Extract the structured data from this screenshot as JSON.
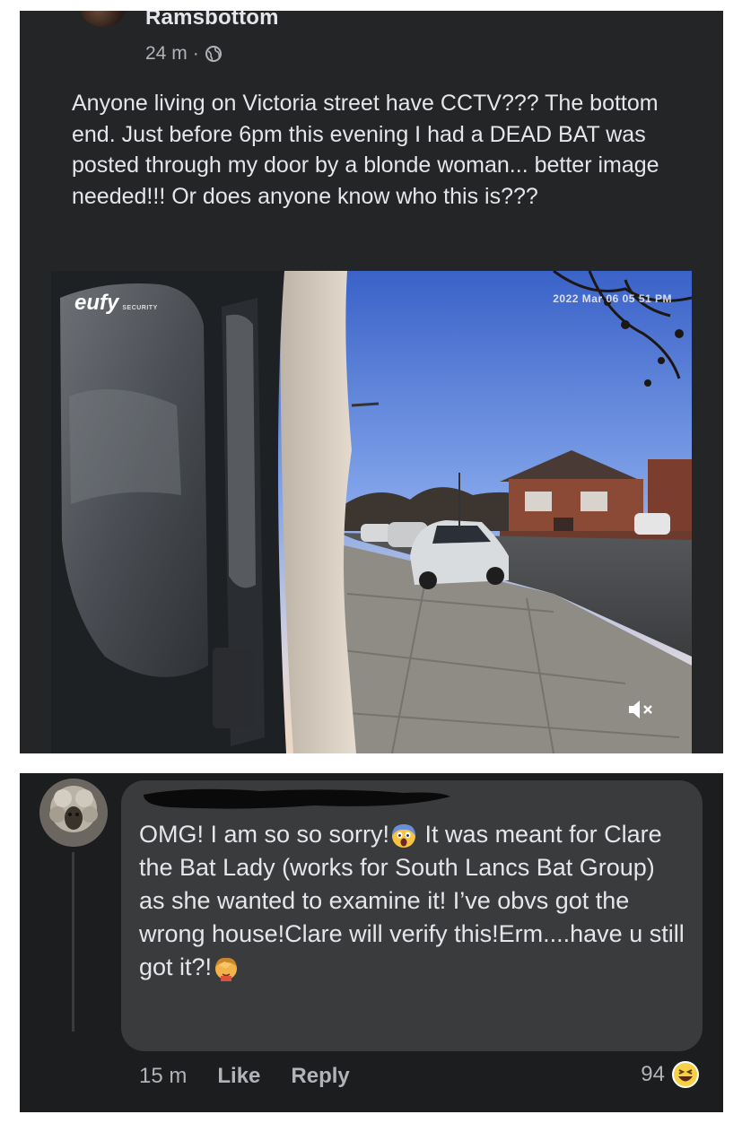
{
  "post": {
    "author": "Ramsbottom",
    "time": "24 m",
    "separator": "·",
    "text": "Anyone living on Victoria street have CCTV??? The bottom end. Just before 6pm this evening I had a DEAD BAT was posted through my door by a blonde woman... better image needed!!! Or does anyone know who this is???"
  },
  "cctv": {
    "brand": "eufy",
    "brand_sub": "SECURITY",
    "timestamp": "2022 Mar 06 05 51 PM"
  },
  "comment": {
    "text_1": "OMG! I am so so sorry!",
    "text_2": " It was meant for Clare the Bat Lady (works for South Lancs Bat Group) as she wanted to examine it! I’ve obvs got the wrong house!Clare will verify this!Erm....have u still got it?!",
    "time": "15 m",
    "like_label": "Like",
    "reply_label": "Reply",
    "reaction_count": "94"
  },
  "icons": {
    "globe": "globe-icon",
    "mute": "speaker-muted-icon",
    "shocked": "screaming-face-emoji",
    "facepalm": "facepalm-emoji",
    "haha": "haha-reaction-icon"
  }
}
